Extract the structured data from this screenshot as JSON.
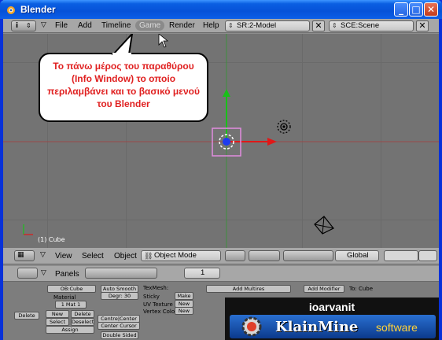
{
  "window": {
    "title": "Blender"
  },
  "info_menu": {
    "items": [
      "File",
      "Add",
      "Timeline",
      "Game",
      "Render",
      "Help"
    ],
    "selected": "Game",
    "screen_field": "SR:2-Model",
    "scene_field": "SCE:Scene"
  },
  "callout": {
    "text": "Το πάνω μέρος του παραθύρου (Info Window) το οποίο περιλαμβάνει και το βασικό μενού του Blender"
  },
  "viewport": {
    "object_label": "(1) Cube"
  },
  "view3d_header": {
    "menus": [
      "View",
      "Select",
      "Object"
    ],
    "mode": "Object Mode",
    "orientation": "Global"
  },
  "buttons_header": {
    "panels_label": "Panels",
    "frame": "1"
  },
  "buttons_panel": {
    "ob_field": "OB:Cube",
    "material_label": "Material",
    "mat_count": "1 Mat 1",
    "delete": "Delete",
    "new": "New",
    "delete2": "Delete",
    "select": "Select",
    "deselect": "Deselect",
    "assign": "Assign",
    "auto_smooth": "Auto Smooth",
    "degr": "Degr: 30",
    "center_new": "Centre|Center Ne",
    "center_cursor": "Center Cursor",
    "double_sided": "Double Sided",
    "texmesh": "TexMesh:",
    "sticky": "Sticky",
    "make": "Make",
    "uv_texture": "UV Texture",
    "new_uv": "New",
    "vertex_color": "Vertex Color",
    "new_vc": "New",
    "add_multires": "Add Multires",
    "add_modifier": "Add Modifier",
    "to_cube": "To: Cube"
  },
  "watermark": {
    "author": "ioarvanit",
    "brand": "KlainMine",
    "suffix": "software"
  },
  "colors": {
    "titlebar": "#0652d8",
    "callout_text": "#e02020",
    "viewport": "#737373"
  }
}
